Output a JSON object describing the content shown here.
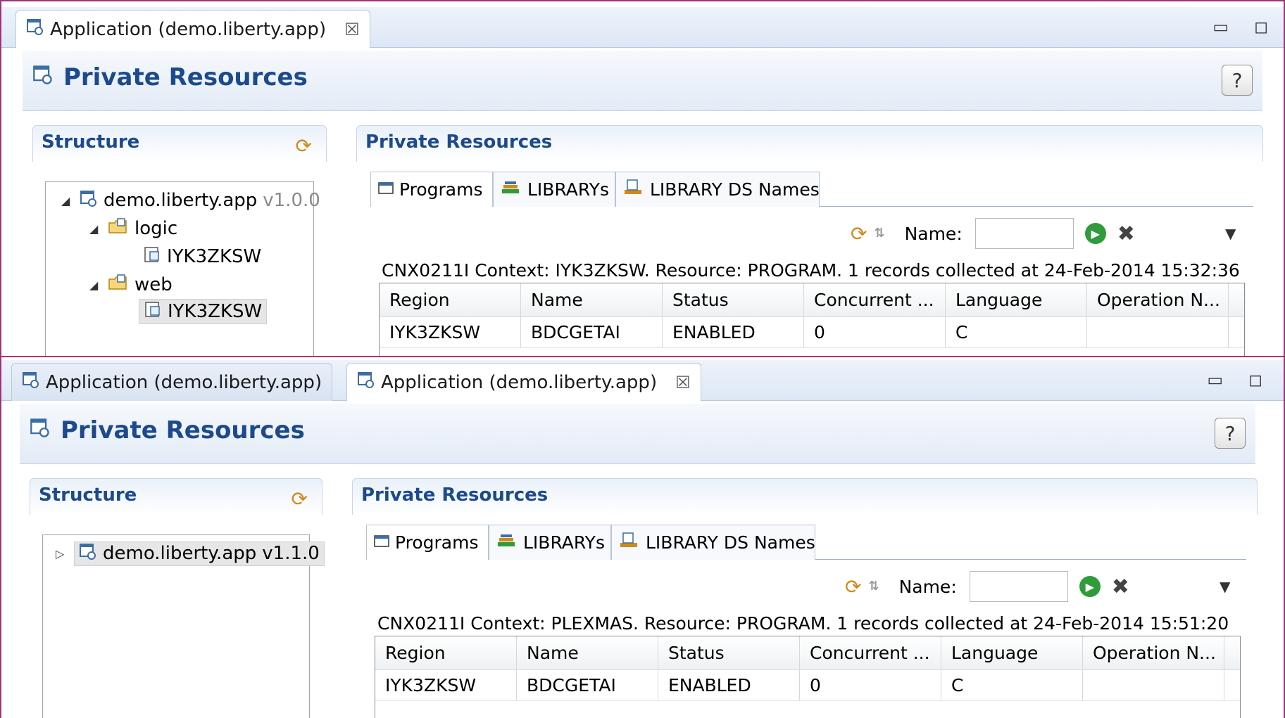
{
  "panels": [
    {
      "editor_tabs": [
        {
          "label": "Application (demo.liberty.app)",
          "active": true,
          "close": "☒"
        }
      ],
      "form_title": "Private Resources",
      "help": "?",
      "structure": {
        "title": "Structure",
        "tree": [
          {
            "label": "demo.liberty.app",
            "version": "v1.0.0",
            "twisty": "◢",
            "icon": "application-icon"
          },
          {
            "label": "logic",
            "twisty": "◢",
            "icon": "bundle-folder-icon"
          },
          {
            "label": "IYK3ZKSW",
            "icon": "region-icon"
          },
          {
            "label": "web",
            "twisty": "◢",
            "icon": "bundle-folder-icon"
          },
          {
            "label": "IYK3ZKSW",
            "icon": "region-icon",
            "selected": true
          }
        ]
      },
      "resources": {
        "title": "Private Resources",
        "tabs": [
          "Programs",
          "LIBRARYs",
          "LIBRARY DS Names"
        ],
        "name_label": "Name:",
        "name_value": "",
        "status": "CNX0211I Context: IYK3ZKSW. Resource: PROGRAM. 1 records collected at 24-Feb-2014 15:32:36",
        "columns": [
          "Region",
          "Name",
          "Status",
          "Concurrent ...",
          "Language",
          "Operation N..."
        ],
        "rows": [
          [
            "IYK3ZKSW",
            "BDCGETAI",
            "ENABLED",
            "0",
            "C",
            ""
          ]
        ]
      }
    },
    {
      "editor_tabs": [
        {
          "label": "Application (demo.liberty.app)",
          "active": false
        },
        {
          "label": "Application (demo.liberty.app)",
          "active": true,
          "close": "☒"
        }
      ],
      "form_title": "Private Resources",
      "help": "?",
      "structure": {
        "title": "Structure",
        "tree": [
          {
            "label": "demo.liberty.app",
            "version": "v1.1.0",
            "twisty": "▷",
            "icon": "application-icon",
            "selected": true
          }
        ]
      },
      "resources": {
        "title": "Private Resources",
        "tabs": [
          "Programs",
          "LIBRARYs",
          "LIBRARY DS Names"
        ],
        "name_label": "Name:",
        "name_value": "",
        "status": "CNX0211I Context: PLEXMAS. Resource: PROGRAM. 1 records collected at 24-Feb-2014 15:51:20",
        "columns": [
          "Region",
          "Name",
          "Status",
          "Concurrent ...",
          "Language",
          "Operation N..."
        ],
        "rows": [
          [
            "IYK3ZKSW",
            "BDCGETAI",
            "ENABLED",
            "0",
            "C",
            ""
          ]
        ]
      }
    }
  ],
  "colors": {
    "accent_title": "#1c4a8c",
    "frame": "#a0317a",
    "run_green": "#2f9b3b"
  }
}
